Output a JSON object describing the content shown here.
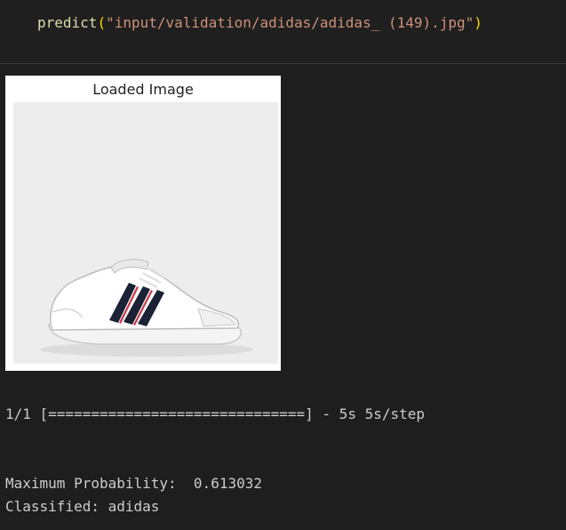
{
  "cell": {
    "code_fn": "predict",
    "code_open": "(",
    "code_arg": "\"input/validation/adidas/adidas_ (149).jpg\"",
    "code_close": ")"
  },
  "output": {
    "figure_title": "Loaded Image",
    "image_subject": "adidas-sneaker",
    "progress_line": "1/1 [==============================] - 5s 5s/step",
    "probability_line": "Maximum Probability:  0.613032",
    "classified_line": "Classified: adidas"
  },
  "colors": {
    "background": "#1f1f1f",
    "function": "#dcdcaa",
    "string": "#ce9178",
    "parenthesis": "#ffd700",
    "stdout_text": "#cccccc"
  }
}
